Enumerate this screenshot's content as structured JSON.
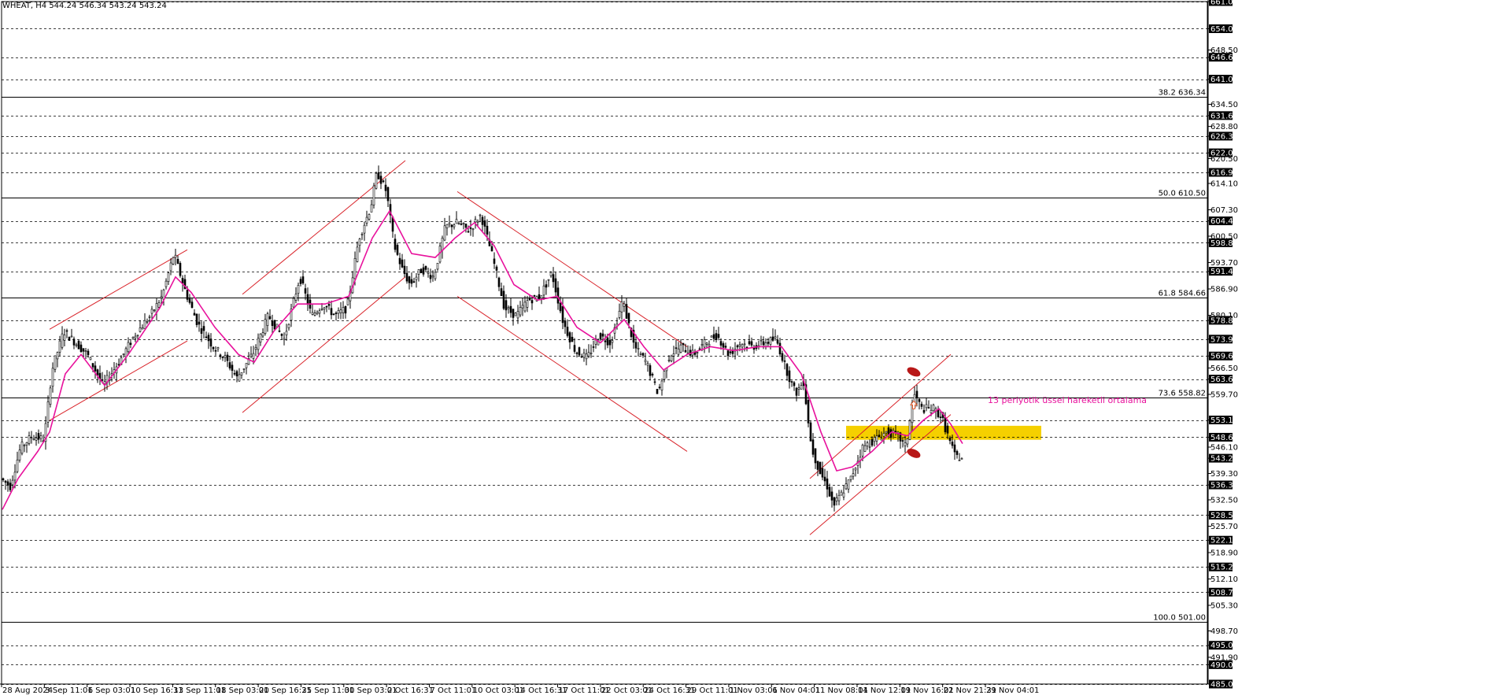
{
  "header": {
    "text": "WHEAT, H4  544.24 546.34 543.24 543.24"
  },
  "chart_data": {
    "type": "candlestick",
    "symbol": "WHEAT",
    "timeframe": "H4",
    "ohlc_header": {
      "open": 544.24,
      "high": 546.34,
      "low": 543.24,
      "close": 543.24
    },
    "ylim": [
      485.0,
      661.0
    ],
    "price_labels": [
      "661.00",
      "654.00",
      "648.50",
      "646.65",
      "641.00",
      "634.50",
      "631.60",
      "628.80",
      "626.30",
      "622.00",
      "620.50",
      "616.95",
      "614.10",
      "607.30",
      "604.45",
      "600.50",
      "598.80",
      "593.70",
      "591.45",
      "586.90",
      "580.10",
      "578.80",
      "573.95",
      "569.60",
      "566.50",
      "563.65",
      "559.70",
      "553.10",
      "548.65",
      "546.10",
      "543.24",
      "539.30",
      "536.35",
      "532.50",
      "528.55",
      "525.70",
      "522.10",
      "518.90",
      "515.20",
      "512.10",
      "508.70",
      "505.30",
      "498.70",
      "495.00",
      "491.90",
      "490.00",
      "485.00"
    ],
    "boxed_price_labels": [
      "661.00",
      "654.00",
      "646.65",
      "641.00",
      "631.60",
      "626.30",
      "622.00",
      "616.95",
      "604.45",
      "598.80",
      "591.45",
      "578.80",
      "573.95",
      "569.60",
      "563.65",
      "553.10",
      "548.65",
      "543.24",
      "536.35",
      "528.55",
      "522.10",
      "515.20",
      "508.70",
      "495.00",
      "490.00",
      "485.00"
    ],
    "horizontal_levels": [
      661.0,
      654.0,
      646.65,
      641.0,
      631.6,
      626.3,
      622.0,
      616.95,
      604.45,
      598.8,
      591.45,
      578.8,
      573.95,
      569.6,
      563.65,
      553.1,
      548.65,
      536.35,
      528.55,
      522.1,
      515.2,
      508.7,
      495.0,
      490.0,
      485.0
    ],
    "fibonacci_levels": [
      {
        "label": "38.2 636.34",
        "price": 636.34
      },
      {
        "label": "50.0 610.50",
        "price": 610.5
      },
      {
        "label": "61.8 584.66",
        "price": 584.66
      },
      {
        "label": "73.6 558.82",
        "price": 558.82
      },
      {
        "label": "100.0 501.00",
        "price": 501.0
      }
    ],
    "x_tick_labels": [
      "28 Aug 2024",
      "3 Sep 11:01",
      "6 Sep 03:01",
      "10 Sep 16:31",
      "13 Sep 11:01",
      "18 Sep 03:01",
      "20 Sep 16:31",
      "25 Sep 11:01",
      "30 Sep 03:01",
      "2 Oct 16:31",
      "7 Oct 11:01",
      "10 Oct 03:01",
      "14 Oct 16:31",
      "17 Oct 11:01",
      "22 Oct 03:01",
      "24 Oct 16:31",
      "29 Oct 11:01",
      "1 Nov 03:01",
      "6 Nov 04:01",
      "11 Nov 08:01",
      "14 Nov 12:01",
      "19 Nov 16:01",
      "22 Nov 21:31",
      "29 Nov 04:01"
    ],
    "close_path": [
      {
        "bar": 0,
        "close": 538
      },
      {
        "bar": 12,
        "close": 536
      },
      {
        "bar": 25,
        "close": 546
      },
      {
        "bar": 40,
        "close": 549
      },
      {
        "bar": 55,
        "close": 548
      },
      {
        "bar": 65,
        "close": 566
      },
      {
        "bar": 80,
        "close": 576
      },
      {
        "bar": 95,
        "close": 573
      },
      {
        "bar": 110,
        "close": 570
      },
      {
        "bar": 130,
        "close": 562
      },
      {
        "bar": 150,
        "close": 568
      },
      {
        "bar": 170,
        "close": 575
      },
      {
        "bar": 190,
        "close": 580
      },
      {
        "bar": 205,
        "close": 585
      },
      {
        "bar": 220,
        "close": 596
      },
      {
        "bar": 235,
        "close": 586
      },
      {
        "bar": 250,
        "close": 578
      },
      {
        "bar": 270,
        "close": 572
      },
      {
        "bar": 285,
        "close": 569
      },
      {
        "bar": 300,
        "close": 564
      },
      {
        "bar": 320,
        "close": 570
      },
      {
        "bar": 340,
        "close": 580
      },
      {
        "bar": 360,
        "close": 574
      },
      {
        "bar": 380,
        "close": 590
      },
      {
        "bar": 395,
        "close": 580
      },
      {
        "bar": 410,
        "close": 583
      },
      {
        "bar": 425,
        "close": 580
      },
      {
        "bar": 440,
        "close": 582
      },
      {
        "bar": 455,
        "close": 600
      },
      {
        "bar": 470,
        "close": 608
      },
      {
        "bar": 478,
        "close": 617
      },
      {
        "bar": 490,
        "close": 612
      },
      {
        "bar": 500,
        "close": 598
      },
      {
        "bar": 510,
        "close": 592
      },
      {
        "bar": 520,
        "close": 588
      },
      {
        "bar": 535,
        "close": 592
      },
      {
        "bar": 550,
        "close": 590
      },
      {
        "bar": 565,
        "close": 603
      },
      {
        "bar": 580,
        "close": 604
      },
      {
        "bar": 595,
        "close": 602
      },
      {
        "bar": 610,
        "close": 606
      },
      {
        "bar": 625,
        "close": 595
      },
      {
        "bar": 640,
        "close": 582
      },
      {
        "bar": 655,
        "close": 580
      },
      {
        "bar": 670,
        "close": 584
      },
      {
        "bar": 685,
        "close": 585
      },
      {
        "bar": 700,
        "close": 591
      },
      {
        "bar": 715,
        "close": 578
      },
      {
        "bar": 730,
        "close": 571
      },
      {
        "bar": 745,
        "close": 569
      },
      {
        "bar": 760,
        "close": 575
      },
      {
        "bar": 775,
        "close": 573
      },
      {
        "bar": 790,
        "close": 584
      },
      {
        "bar": 805,
        "close": 572
      },
      {
        "bar": 820,
        "close": 568
      },
      {
        "bar": 835,
        "close": 560
      },
      {
        "bar": 850,
        "close": 570
      },
      {
        "bar": 865,
        "close": 572
      },
      {
        "bar": 880,
        "close": 570
      },
      {
        "bar": 895,
        "close": 573
      },
      {
        "bar": 910,
        "close": 575
      },
      {
        "bar": 925,
        "close": 570
      },
      {
        "bar": 940,
        "close": 573
      },
      {
        "bar": 955,
        "close": 572
      },
      {
        "bar": 970,
        "close": 573
      },
      {
        "bar": 985,
        "close": 574
      },
      {
        "bar": 1000,
        "close": 565
      },
      {
        "bar": 1010,
        "close": 560
      },
      {
        "bar": 1020,
        "close": 563
      },
      {
        "bar": 1030,
        "close": 546
      },
      {
        "bar": 1040,
        "close": 540
      },
      {
        "bar": 1050,
        "close": 536
      },
      {
        "bar": 1058,
        "close": 531
      },
      {
        "bar": 1068,
        "close": 534
      },
      {
        "bar": 1080,
        "close": 538
      },
      {
        "bar": 1095,
        "close": 546
      },
      {
        "bar": 1110,
        "close": 548
      },
      {
        "bar": 1125,
        "close": 550
      },
      {
        "bar": 1140,
        "close": 549
      },
      {
        "bar": 1150,
        "close": 546
      },
      {
        "bar": 1160,
        "close": 560
      },
      {
        "bar": 1170,
        "close": 556
      },
      {
        "bar": 1185,
        "close": 556
      },
      {
        "bar": 1195,
        "close": 554
      },
      {
        "bar": 1205,
        "close": 548
      },
      {
        "bar": 1212,
        "close": 544
      },
      {
        "bar": 1220,
        "close": 543.24
      }
    ],
    "ema13_path": [
      {
        "bar": 0,
        "close": 530
      },
      {
        "bar": 20,
        "close": 538
      },
      {
        "bar": 45,
        "close": 545
      },
      {
        "bar": 60,
        "close": 550
      },
      {
        "bar": 80,
        "close": 565
      },
      {
        "bar": 100,
        "close": 570
      },
      {
        "bar": 130,
        "close": 562
      },
      {
        "bar": 160,
        "close": 570
      },
      {
        "bar": 200,
        "close": 582
      },
      {
        "bar": 220,
        "close": 590
      },
      {
        "bar": 240,
        "close": 586
      },
      {
        "bar": 270,
        "close": 577
      },
      {
        "bar": 300,
        "close": 570
      },
      {
        "bar": 320,
        "close": 568
      },
      {
        "bar": 345,
        "close": 576
      },
      {
        "bar": 375,
        "close": 583
      },
      {
        "bar": 410,
        "close": 583
      },
      {
        "bar": 440,
        "close": 585
      },
      {
        "bar": 470,
        "close": 600
      },
      {
        "bar": 492,
        "close": 607
      },
      {
        "bar": 520,
        "close": 596
      },
      {
        "bar": 550,
        "close": 595
      },
      {
        "bar": 575,
        "close": 600
      },
      {
        "bar": 600,
        "close": 604
      },
      {
        "bar": 625,
        "close": 598
      },
      {
        "bar": 650,
        "close": 588
      },
      {
        "bar": 680,
        "close": 584
      },
      {
        "bar": 705,
        "close": 585
      },
      {
        "bar": 730,
        "close": 577
      },
      {
        "bar": 760,
        "close": 573
      },
      {
        "bar": 790,
        "close": 579
      },
      {
        "bar": 815,
        "close": 572
      },
      {
        "bar": 840,
        "close": 566
      },
      {
        "bar": 870,
        "close": 570
      },
      {
        "bar": 900,
        "close": 572
      },
      {
        "bar": 930,
        "close": 571
      },
      {
        "bar": 960,
        "close": 572
      },
      {
        "bar": 990,
        "close": 572
      },
      {
        "bar": 1015,
        "close": 565
      },
      {
        "bar": 1040,
        "close": 550
      },
      {
        "bar": 1060,
        "close": 540
      },
      {
        "bar": 1080,
        "close": 541
      },
      {
        "bar": 1105,
        "close": 545
      },
      {
        "bar": 1130,
        "close": 550
      },
      {
        "bar": 1150,
        "close": 549
      },
      {
        "bar": 1170,
        "close": 553
      },
      {
        "bar": 1190,
        "close": 556
      },
      {
        "bar": 1205,
        "close": 552
      },
      {
        "bar": 1220,
        "close": 547
      }
    ],
    "channels": [
      {
        "a": [
          60,
          576.5
        ],
        "b": [
          235,
          597.0
        ]
      },
      {
        "a": [
          60,
          553.0
        ],
        "b": [
          235,
          573.5
        ]
      },
      {
        "a": [
          305,
          585.5
        ],
        "b": [
          512,
          620.0
        ]
      },
      {
        "a": [
          305,
          555.0
        ],
        "b": [
          512,
          590.0
        ]
      },
      {
        "a": [
          578,
          612.0
        ],
        "b": [
          870,
          572.0
        ]
      },
      {
        "a": [
          578,
          585.0
        ],
        "b": [
          870,
          545.0
        ]
      },
      {
        "a": [
          1026,
          538.0
        ],
        "b": [
          1205,
          570.0
        ]
      },
      {
        "a": [
          1026,
          523.5
        ],
        "b": [
          1205,
          554.5
        ]
      }
    ],
    "highlight_zone": {
      "start_bar": 1072,
      "end_bar": 1320,
      "price_low": 548.0,
      "price_high": 551.6
    },
    "annotations": [
      {
        "text": "13 periyotlk üssel hareketli ortalama",
        "bar": 1225,
        "price": 557.5
      }
    ],
    "markers": [
      {
        "bar": 1158,
        "price": 565.5,
        "shape": "ellipse"
      },
      {
        "bar": 1158,
        "price": 544.5,
        "shape": "ellipse"
      },
      {
        "bar": 1158,
        "price": 557.0,
        "shape": "arrow-up"
      }
    ],
    "colors": {
      "candles": "#000000",
      "ema": "#e8119c",
      "channels": "#d9232a",
      "grid": "#000000",
      "highlight": "#f5d000",
      "annotation": "#e8119c",
      "markers": "#b81818"
    }
  }
}
